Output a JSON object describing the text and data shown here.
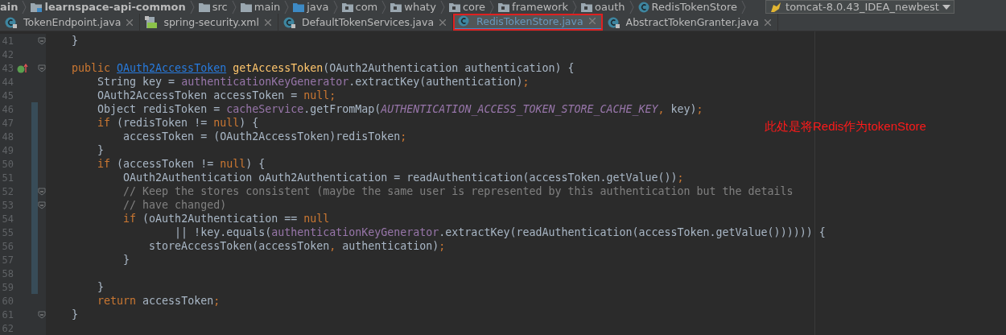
{
  "breadcrumbs": [
    {
      "label": "ain",
      "kind": "text"
    },
    {
      "label": "learnspace-api-common",
      "kind": "module"
    },
    {
      "label": "src",
      "kind": "folder"
    },
    {
      "label": "main",
      "kind": "folder"
    },
    {
      "label": "java",
      "kind": "source"
    },
    {
      "label": "com",
      "kind": "package"
    },
    {
      "label": "whaty",
      "kind": "package"
    },
    {
      "label": "core",
      "kind": "package"
    },
    {
      "label": "framework",
      "kind": "package"
    },
    {
      "label": "oauth",
      "kind": "package"
    },
    {
      "label": "RedisTokenStore",
      "kind": "class"
    }
  ],
  "run_config": "tomcat-8.0.43_IDEA_newbest",
  "tabs": [
    {
      "label": "TokenEndpoint.java",
      "kind": "class",
      "locked": true,
      "selected": false,
      "highlighted": false
    },
    {
      "label": "spring-security.xml",
      "kind": "xml",
      "locked": true,
      "selected": false,
      "highlighted": false
    },
    {
      "label": "DefaultTokenServices.java",
      "kind": "class",
      "locked": true,
      "selected": false,
      "highlighted": false
    },
    {
      "label": "RedisTokenStore.java",
      "kind": "class",
      "locked": false,
      "selected": true,
      "highlighted": true
    },
    {
      "label": "AbstractTokenGranter.java",
      "kind": "class",
      "locked": true,
      "selected": false,
      "highlighted": false
    }
  ],
  "lines": [
    {
      "number": "41",
      "marker": false,
      "fold": true,
      "changed": false,
      "segments": [
        {
          "kind": "plain",
          "text": "    }"
        }
      ]
    },
    {
      "number": "42",
      "marker": false,
      "fold": false,
      "changed": false
    },
    {
      "number": "43",
      "marker": true,
      "fold": true,
      "changed": false,
      "segments": [
        {
          "kind": "keyword",
          "text": "    public "
        },
        {
          "kind": "link",
          "text": "OAuth2AccessToken"
        },
        {
          "kind": "method",
          "text": " getAccessToken"
        },
        {
          "kind": "plain",
          "text": "(OAuth2Authentication authentication) {"
        }
      ]
    },
    {
      "number": "44",
      "marker": false,
      "fold": false,
      "changed": false,
      "segments": [
        {
          "kind": "plain",
          "text": "        String key = "
        },
        {
          "kind": "field",
          "text": "authenticationKeyGenerator"
        },
        {
          "kind": "plain",
          "text": ".extractKey(authentication)"
        },
        {
          "kind": "keyword",
          "text": ";"
        }
      ]
    },
    {
      "number": "45",
      "marker": false,
      "fold": false,
      "changed": false,
      "segments": [
        {
          "kind": "plain",
          "text": "        OAuth2AccessToken accessToken = "
        },
        {
          "kind": "keyword",
          "text": "null;"
        }
      ]
    },
    {
      "number": "46",
      "marker": false,
      "fold": false,
      "changed": true,
      "segments": [
        {
          "kind": "plain",
          "text": "        Object redisToken = "
        },
        {
          "kind": "field",
          "text": "cacheService"
        },
        {
          "kind": "plain",
          "text": ".getFromMap("
        },
        {
          "kind": "constant",
          "text": "AUTHENTICATION_ACCESS_TOKEN_STORE_CACHE_KEY"
        },
        {
          "kind": "keyword",
          "text": ", "
        },
        {
          "kind": "plain",
          "text": "key)"
        },
        {
          "kind": "keyword",
          "text": ";"
        }
      ]
    },
    {
      "number": "47",
      "marker": false,
      "fold": false,
      "changed": true,
      "segments": [
        {
          "kind": "keyword",
          "text": "        if "
        },
        {
          "kind": "plain",
          "text": "(redisToken != "
        },
        {
          "kind": "keyword",
          "text": "null"
        },
        {
          "kind": "plain",
          "text": ") {"
        }
      ]
    },
    {
      "number": "48",
      "marker": false,
      "fold": false,
      "changed": true,
      "segments": [
        {
          "kind": "plain",
          "text": "            accessToken = (OAuth2AccessToken)redisToken"
        },
        {
          "kind": "keyword",
          "text": ";"
        }
      ]
    },
    {
      "number": "49",
      "marker": false,
      "fold": false,
      "changed": true,
      "segments": [
        {
          "kind": "plain",
          "text": "        }"
        }
      ]
    },
    {
      "number": "50",
      "marker": false,
      "fold": false,
      "changed": true,
      "segments": [
        {
          "kind": "keyword",
          "text": "        if "
        },
        {
          "kind": "plain",
          "text": "(accessToken != "
        },
        {
          "kind": "keyword",
          "text": "null"
        },
        {
          "kind": "plain",
          "text": ") {"
        }
      ]
    },
    {
      "number": "51",
      "marker": false,
      "fold": false,
      "changed": true,
      "segments": [
        {
          "kind": "plain",
          "text": "            OAuth2Authentication oAuth2Authentication = readAuthentication(accessToken.getValue())"
        },
        {
          "kind": "keyword",
          "text": ";"
        }
      ]
    },
    {
      "number": "52",
      "marker": false,
      "fold": true,
      "changed": true,
      "segments": [
        {
          "kind": "comment",
          "text": "            // Keep the stores consistent (maybe the same user is represented by this authentication but the details"
        }
      ]
    },
    {
      "number": "53",
      "marker": false,
      "fold": true,
      "changed": true,
      "segments": [
        {
          "kind": "comment",
          "text": "            // have changed)"
        }
      ]
    },
    {
      "number": "54",
      "marker": false,
      "fold": false,
      "changed": true,
      "segments": [
        {
          "kind": "keyword",
          "text": "            if "
        },
        {
          "kind": "plain",
          "text": "(oAuth2Authentication == "
        },
        {
          "kind": "keyword",
          "text": "null"
        }
      ]
    },
    {
      "number": "55",
      "marker": false,
      "fold": false,
      "changed": true,
      "segments": [
        {
          "kind": "plain",
          "text": "                    || !key.equals("
        },
        {
          "kind": "field",
          "text": "authenticationKeyGenerator"
        },
        {
          "kind": "plain",
          "text": ".extractKey(readAuthentication(accessToken.getValue()))))) {"
        }
      ]
    },
    {
      "number": "56",
      "marker": false,
      "fold": false,
      "changed": true,
      "segments": [
        {
          "kind": "plain",
          "text": "                storeAccessToken(accessToken"
        },
        {
          "kind": "keyword",
          "text": ", "
        },
        {
          "kind": "plain",
          "text": "authentication)"
        },
        {
          "kind": "keyword",
          "text": ";"
        }
      ]
    },
    {
      "number": "57",
      "marker": false,
      "fold": false,
      "changed": true,
      "segments": [
        {
          "kind": "plain",
          "text": "            }"
        }
      ]
    },
    {
      "number": "58",
      "marker": false,
      "fold": false,
      "changed": true
    },
    {
      "number": "59",
      "marker": false,
      "fold": false,
      "changed": true,
      "segments": [
        {
          "kind": "plain",
          "text": "        }"
        }
      ]
    },
    {
      "number": "60",
      "marker": false,
      "fold": false,
      "changed": false,
      "segments": [
        {
          "kind": "keyword",
          "text": "        return "
        },
        {
          "kind": "plain",
          "text": "accessToken"
        },
        {
          "kind": "keyword",
          "text": ";"
        }
      ]
    },
    {
      "number": "61",
      "marker": false,
      "fold": true,
      "changed": false,
      "segments": [
        {
          "kind": "plain",
          "text": "    }"
        }
      ]
    },
    {
      "number": "62",
      "marker": false,
      "fold": false,
      "changed": false
    }
  ],
  "annotation": "此处是将Redis作为tokenStore"
}
